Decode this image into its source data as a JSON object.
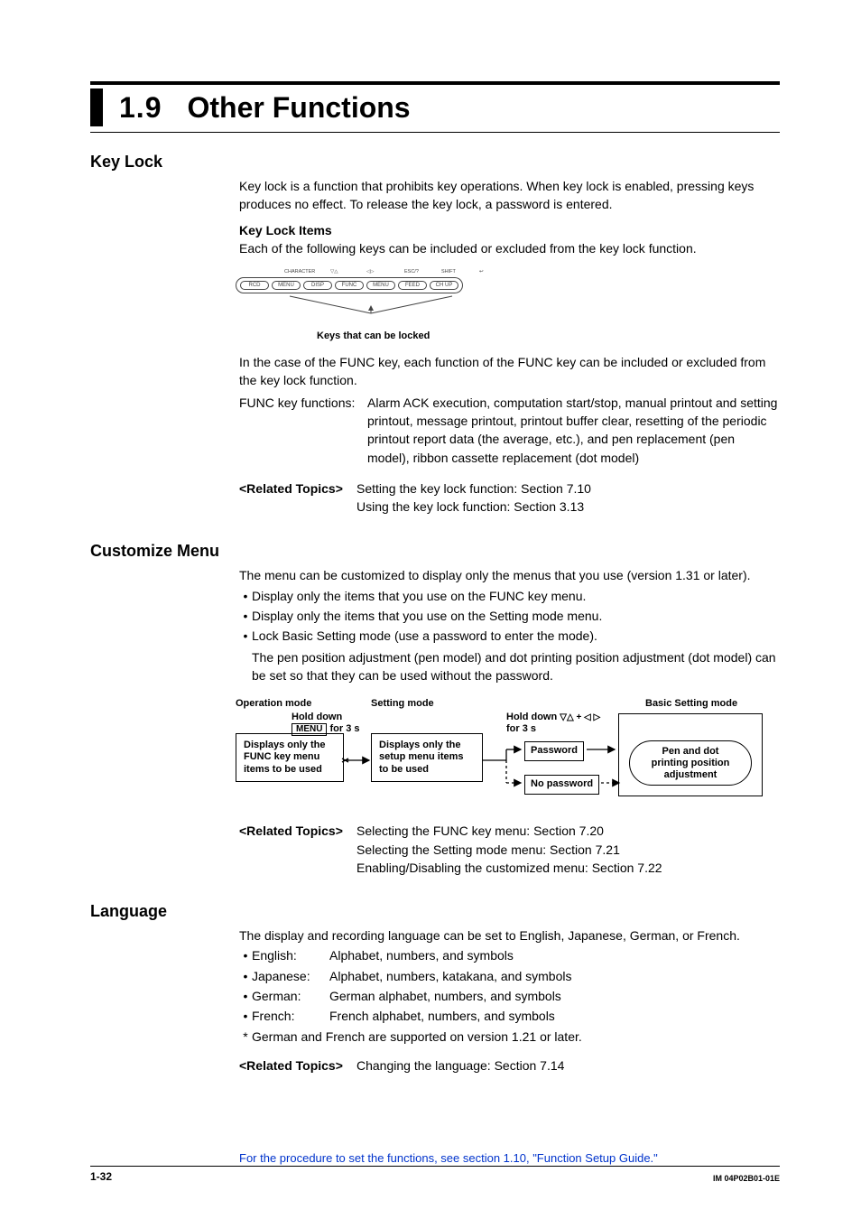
{
  "header": {
    "secnum": "1.9",
    "title": "Other Functions"
  },
  "keylock": {
    "heading": "Key Lock",
    "p1": "Key lock is a function that prohibits key operations. When key lock is enabled, pressing keys produces no effect. To release the key lock, a password is entered.",
    "h3": "Key Lock Items",
    "p2": "Each of the following keys can be included or excluded from the key lock function.",
    "keys_caption": "Keys that can be locked",
    "key_labels_top": [
      "CHARACTER",
      "▽△",
      "◁▷",
      "ESC/?",
      "SHIFT",
      "↩"
    ],
    "key_buttons": [
      "RCD",
      "MENU",
      "DISP",
      "FUNC",
      "MENU",
      "FEED",
      "CH UP"
    ],
    "p3": "In the case of the FUNC key, each function of the FUNC key can be included or excluded from the key lock function.",
    "func_label": "FUNC key functions:",
    "func_desc": "Alarm ACK execution, computation start/stop, manual printout and setting printout, message printout, printout buffer clear, resetting of the periodic printout report data (the average, etc.), and pen replacement (pen model), ribbon cassette replacement (dot model)",
    "related_label": "<Related Topics>",
    "related1": "Setting the key lock function: Section 7.10",
    "related2": "Using the key lock function: Section 3.13"
  },
  "customize": {
    "heading": "Customize Menu",
    "p1": "The menu can be customized to display only the menus that you use (version 1.31 or later).",
    "b1": "Display only the items that you use on the FUNC key menu.",
    "b2": "Display only the items that you use on the Setting mode menu.",
    "b3": "Lock Basic Setting mode (use a password to enter the mode).",
    "b3_cont": "The pen position adjustment (pen model) and dot printing position adjustment (dot model) can be set so that they can be used without the password.",
    "diagram": {
      "op_mode": "Operation mode",
      "set_mode": "Setting mode",
      "basic_mode": "Basic Setting mode",
      "op_box": "Displays only the\nFUNC key menu\nitems to be used",
      "hold1a": "Hold down",
      "hold1b": "for 3 s",
      "set_box": "Displays only the\nsetup menu items\nto be used",
      "hold2a": "Hold down",
      "hold2b": "for 3 s",
      "hold2_sym": "▽△  +  ◁ ▷",
      "password": "Password",
      "nopassword": "No password",
      "pill": "Pen and dot\nprinting position\nadjustment",
      "menu_chip": "MENU"
    },
    "related_label": "<Related Topics>",
    "r1": "Selecting the FUNC key menu: Section 7.20",
    "r2": "Selecting the Setting mode menu: Section 7.21",
    "r3": "Enabling/Disabling the customized menu: Section 7.22"
  },
  "language": {
    "heading": "Language",
    "p1": "The display and recording language can be set to English, Japanese, German, or French.",
    "items": [
      {
        "lang": "English:",
        "desc": "Alphabet, numbers, and symbols"
      },
      {
        "lang": "Japanese:",
        "desc": "Alphabet, numbers, katakana, and symbols"
      },
      {
        "lang": "German:",
        "desc": "German alphabet, numbers, and symbols"
      },
      {
        "lang": "French:",
        "desc": "French alphabet, numbers, and symbols"
      }
    ],
    "note": "German and French are supported on version 1.21 or later.",
    "related_label": "<Related Topics>",
    "r1": "Changing the language: Section 7.14"
  },
  "footer": {
    "procnote": "For the procedure to set the functions, see section 1.10, \"Function Setup Guide.\"",
    "page": "1-32",
    "docid": "IM 04P02B01-01E"
  }
}
